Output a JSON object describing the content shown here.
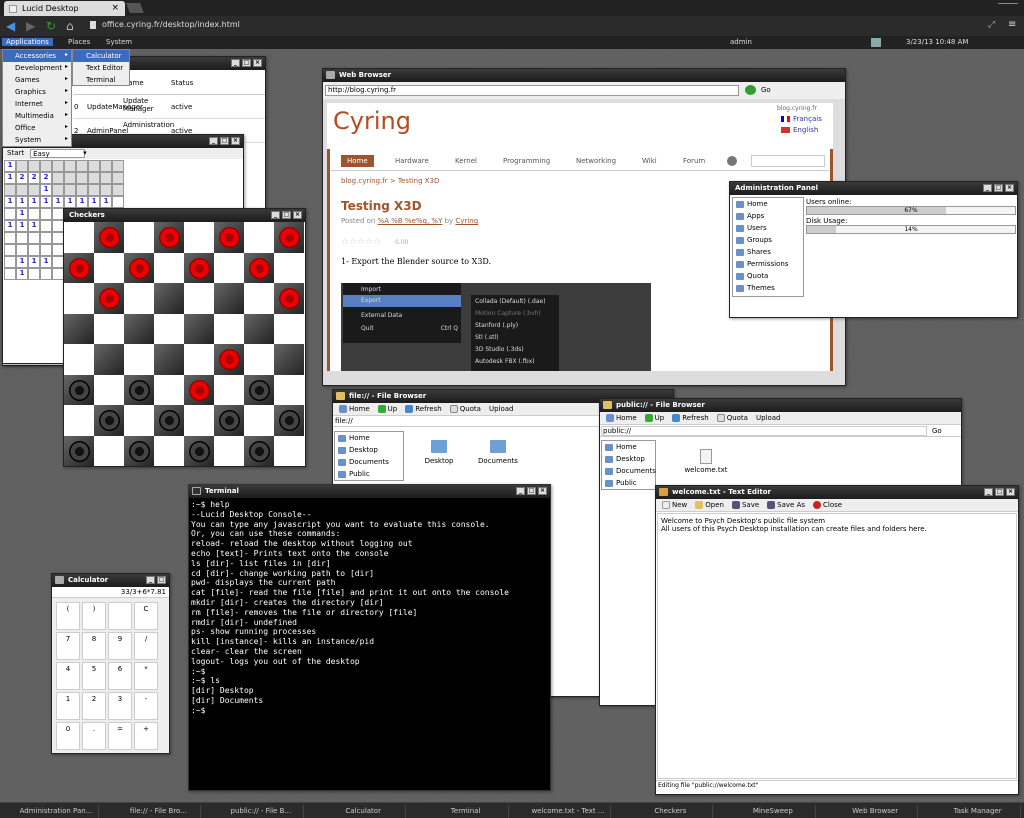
{
  "browser": {
    "tab_title": "Lucid Desktop",
    "tab_close": "×",
    "url": "office.cyring.fr/desktop/index.html"
  },
  "topbar": {
    "menus": [
      "Applications",
      "Places",
      "System"
    ],
    "user": "admin",
    "datetime": "3/23/13 10:48 AM"
  },
  "app_menu": {
    "items": [
      "Accessories",
      "Development",
      "Games",
      "Graphics",
      "Internet",
      "Multimedia",
      "Office",
      "System"
    ],
    "submenu": [
      "Calculator",
      "Text Editor",
      "Terminal"
    ]
  },
  "task_manager": {
    "headers": [
      "Item Name",
      "Name",
      "Status"
    ],
    "rows": [
      [
        "0",
        "UpdateManager",
        "Update Manager",
        "active"
      ],
      [
        "2",
        "AdminPanel",
        "Administration",
        "active"
      ]
    ]
  },
  "minesweep": {
    "start_label": "Start",
    "difficulty": "Easy",
    "grid": [
      [
        "1",
        "",
        "",
        "",
        "",
        "",
        "",
        "",
        "",
        ""
      ],
      [
        "1",
        "2",
        "2",
        "2",
        "",
        "",
        "",
        "",
        "",
        ""
      ],
      [
        "",
        "",
        "",
        "1",
        "",
        "",
        "",
        "",
        "",
        ""
      ],
      [
        "1",
        "1",
        "1",
        "1",
        "1",
        "1",
        "1",
        "1",
        "1",
        ""
      ],
      [
        "",
        "1",
        "",
        "",
        "",
        "",
        "",
        "",
        "",
        ""
      ],
      [
        "1",
        "1",
        "1",
        "",
        "",
        "",
        "",
        "",
        "",
        ""
      ],
      [
        "",
        "",
        "",
        "",
        "",
        "",
        "",
        "",
        "",
        ""
      ],
      [
        "",
        "",
        "",
        "",
        "",
        "",
        "",
        "",
        "",
        ""
      ],
      [
        "",
        "1",
        "1",
        "1",
        "",
        "",
        "",
        "",
        "",
        ""
      ],
      [
        "",
        "1",
        "",
        "",
        "",
        "",
        "",
        "",
        "",
        ""
      ]
    ]
  },
  "checkers": {
    "title": "Checkers",
    "board": [
      [
        "",
        "r",
        "",
        "r",
        "",
        "r",
        "",
        "r"
      ],
      [
        "r",
        "",
        "r",
        "",
        "r",
        "",
        "r",
        ""
      ],
      [
        "",
        "r",
        "",
        "",
        "",
        "",
        "",
        "r"
      ],
      [
        "",
        "",
        "",
        "",
        "",
        "",
        "",
        ""
      ],
      [
        "",
        "",
        "",
        "",
        "",
        "r",
        "",
        ""
      ],
      [
        "b",
        "",
        "b",
        "",
        "r",
        "",
        "b",
        ""
      ],
      [
        "",
        "b",
        "",
        "b",
        "",
        "b",
        "",
        "b"
      ],
      [
        "b",
        "",
        "b",
        "",
        "b",
        "",
        "b",
        ""
      ]
    ]
  },
  "web_browser": {
    "title": "Web Browser",
    "url": "http://blog.cyring.fr",
    "go_label": "Go",
    "site_logo": "Cyring",
    "site_url": "blog.cyring.fr",
    "lang_fr": "Français",
    "lang_en": "English",
    "nav": [
      "Home",
      "Hardware",
      "Kernel",
      "Programming",
      "Networking",
      "Wiki",
      "Forum"
    ],
    "breadcrumb": "blog.cyring.fr > Testing X3D",
    "post_title": "Testing X3D",
    "post_meta_prefix": "Posted on",
    "post_meta_date": "%A %B %e%q, %Y",
    "post_meta_by": "by",
    "post_meta_author": "Cyring",
    "rating": "0.00",
    "post_text": "1- Export the Blender source to X3D.",
    "blender_menu": [
      "Import",
      "Export",
      "External Data",
      "Quit"
    ],
    "quit_shortcut": "Ctrl Q",
    "blender_submenu": [
      "Collada (Default) (.dae)",
      "Motion Capture (.bvh)",
      "Stanford (.ply)",
      "Stl (.stl)",
      "3D Studio (.3ds)",
      "Autodesk FBX (.fbx)"
    ]
  },
  "admin_panel": {
    "title": "Administration Panel",
    "items": [
      "Home",
      "Apps",
      "Users",
      "Groups",
      "Shares",
      "Permissions",
      "Quota",
      "Themes"
    ],
    "users_online_label": "Users online:",
    "users_online_pct": 67,
    "users_online_text": "67%",
    "disk_label": "Disk Usage:",
    "disk_pct": 14,
    "disk_text": "14%"
  },
  "file_browser_1": {
    "title": "file:// - File Browser",
    "toolbar": [
      "Home",
      "Up",
      "Refresh",
      "Quota",
      "Upload"
    ],
    "path": "file://",
    "sidebar": [
      "Home",
      "Desktop",
      "Documents",
      "Public"
    ],
    "files": [
      "Desktop",
      "Documents"
    ]
  },
  "file_browser_2": {
    "title": "public:// - File Browser",
    "toolbar": [
      "Home",
      "Up",
      "Refresh",
      "Quota",
      "Upload"
    ],
    "path": "public://",
    "go_label": "Go",
    "sidebar": [
      "Home",
      "Desktop",
      "Documents",
      "Public"
    ],
    "files": [
      "welcome.txt"
    ]
  },
  "text_editor": {
    "title": "welcome.txt - Text Editor",
    "toolbar": [
      "New",
      "Open",
      "Save",
      "Save As",
      "Close"
    ],
    "content_line1": "Welcome to Psych Desktop's public file system",
    "content_line2": "All users of this Psych Desktop installation can create files and folders here.",
    "status": "Editing file \"public://welcome.txt\""
  },
  "terminal": {
    "title": "Terminal",
    "text": ":~$ help\n--Lucid Desktop Console--\nYou can type any javascript you want to evaluate this console.\nOr, you can use these commands:\nreload- reload the desktop without logging out\necho [text]- Prints text onto the console\nls [dir]- list files in [dir]\ncd [dir]- change working path to [dir]\npwd- displays the current path\ncat [file]- read the file [file] and print it out onto the console\nmkdir [dir]- creates the directory [dir]\nrm [file]- removes the file or directory [file]\nrmdir [dir]- undefined\nps- show running processes\nkill [instance]- kills an instance/pid\nclear- clear the screen\nlogout- logs you out of the desktop\n:~$\n:~$ ls\n[dir] Desktop\n[dir] Documents\n:~$"
  },
  "calculator": {
    "title": "Calculator",
    "display": "33/3+6*7.81",
    "keys": [
      "(",
      ")",
      "",
      "C",
      "7",
      "8",
      "9",
      "/",
      "4",
      "5",
      "6",
      "*",
      "1",
      "2",
      "3",
      "-",
      "0",
      ".",
      "=",
      "+"
    ]
  },
  "taskbar": [
    "Administration Pan...",
    "file:// - File Bro...",
    "public:// - File B...",
    "Calculator",
    "Terminal",
    "welcome.txt - Text ...",
    "Checkers",
    "MineSweep",
    "Web Browser",
    "Task Manager"
  ]
}
